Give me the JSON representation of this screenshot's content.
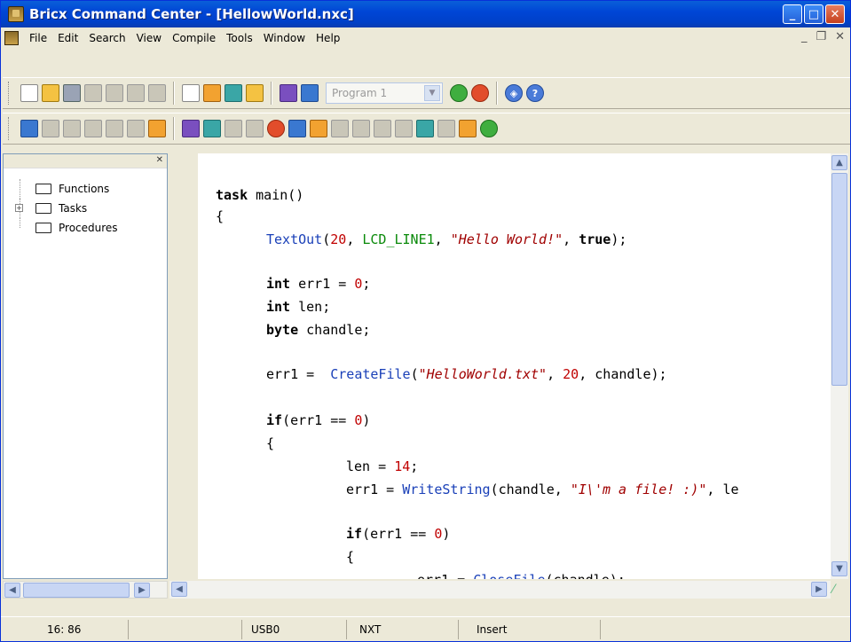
{
  "window": {
    "title": "Bricx Command Center - [HellowWorld.nxc]"
  },
  "menubar": {
    "items": [
      "File",
      "Edit",
      "Search",
      "View",
      "Compile",
      "Tools",
      "Window",
      "Help"
    ]
  },
  "toolbar": {
    "program_select": "Program 1"
  },
  "tree": {
    "items": [
      "Functions",
      "Tasks",
      "Procedures"
    ]
  },
  "statusbar": {
    "position": "16: 86",
    "port": "USB0",
    "brick": "NXT",
    "mode": "Insert"
  }
}
